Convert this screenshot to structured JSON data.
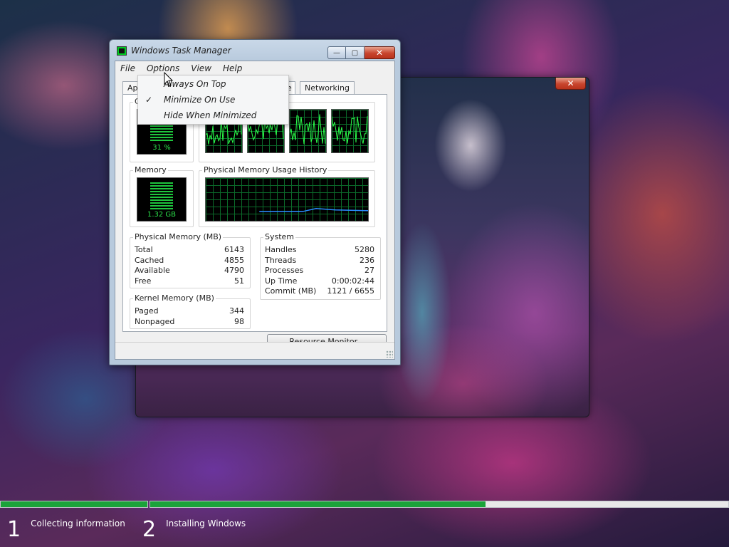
{
  "art_window": {
    "close_glyph": "✕"
  },
  "task_manager": {
    "title": "Windows Task Manager",
    "caption": {
      "minimize": "—",
      "maximize": "▢",
      "close": "✕"
    },
    "menu": [
      "File",
      "Options",
      "View",
      "Help"
    ],
    "tabs": {
      "applications": "App",
      "performance": "e",
      "networking": "Networking"
    },
    "cpu": {
      "label": "C",
      "value": "31 %",
      "level": 0.31
    },
    "memory": {
      "label": "Memory",
      "value": "1.32 GB"
    },
    "memory_history": {
      "label": "Physical Memory Usage History"
    },
    "physical_memory": {
      "title": "Physical Memory (MB)",
      "rows": [
        {
          "label": "Total",
          "value": "6143"
        },
        {
          "label": "Cached",
          "value": "4855"
        },
        {
          "label": "Available",
          "value": "4790"
        },
        {
          "label": "Free",
          "value": "51"
        }
      ]
    },
    "kernel_memory": {
      "title": "Kernel Memory (MB)",
      "rows": [
        {
          "label": "Paged",
          "value": "344"
        },
        {
          "label": "Nonpaged",
          "value": "98"
        }
      ]
    },
    "system": {
      "title": "System",
      "rows": [
        {
          "label": "Handles",
          "value": "5280"
        },
        {
          "label": "Threads",
          "value": "236"
        },
        {
          "label": "Processes",
          "value": "27"
        },
        {
          "label": "Up Time",
          "value": "0:00:02:44"
        },
        {
          "label": "Commit (MB)",
          "value": "1121 / 6655"
        }
      ]
    },
    "resource_monitor_button": "Resource Monitor..."
  },
  "options_menu": {
    "items": [
      {
        "label": "Always On Top",
        "checked": false
      },
      {
        "label": "Minimize On Use",
        "checked": true
      },
      {
        "label": "Hide When Minimized",
        "checked": false
      }
    ],
    "check_glyph": "✓"
  },
  "setup": {
    "progress_color": "#1ba33a",
    "segment1_progress": 1.0,
    "segment2_progress": 0.58,
    "steps": [
      {
        "number": "1",
        "label": "Collecting information"
      },
      {
        "number": "2",
        "label": "Installing Windows"
      }
    ]
  }
}
